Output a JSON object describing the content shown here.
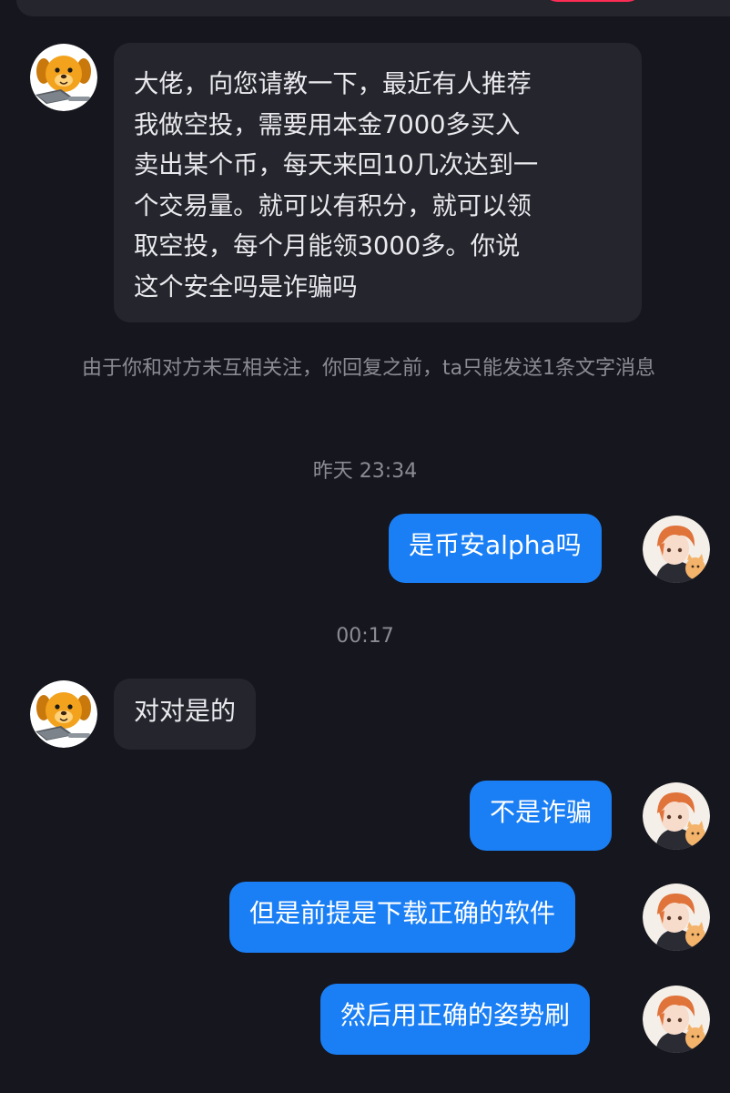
{
  "messages": {
    "m1": "大佬，向您请教一下，最近有人推荐\n我做空投，需要用本金7000多买入\n卖出某个币，每天来回10几次达到一\n个交易量。就可以有积分，就可以领\n取空投，每个月能领3000多。你说\n这个安全吗是诈骗吗",
    "m2": "是币安alpha吗",
    "m3": "对对是的",
    "m4": "不是诈骗",
    "m5": "但是前提是下载正确的软件",
    "m6": "然后用正确的姿势刷"
  },
  "system_note": "由于你和对方未互相关注，你回复之前，ta只能发送1条文字消息",
  "timestamps": {
    "t1": "昨天 23:34",
    "t2": "00:17"
  },
  "colors": {
    "background": "#16161e",
    "incoming_bubble": "#25252d",
    "outgoing_bubble": "#1a7ff5",
    "muted_text": "#8b8b94",
    "accent_red": "#fe2c55"
  },
  "avatars": {
    "other": "dog-with-laptop-avatar",
    "self": "anime-boy-with-cat-avatar"
  }
}
